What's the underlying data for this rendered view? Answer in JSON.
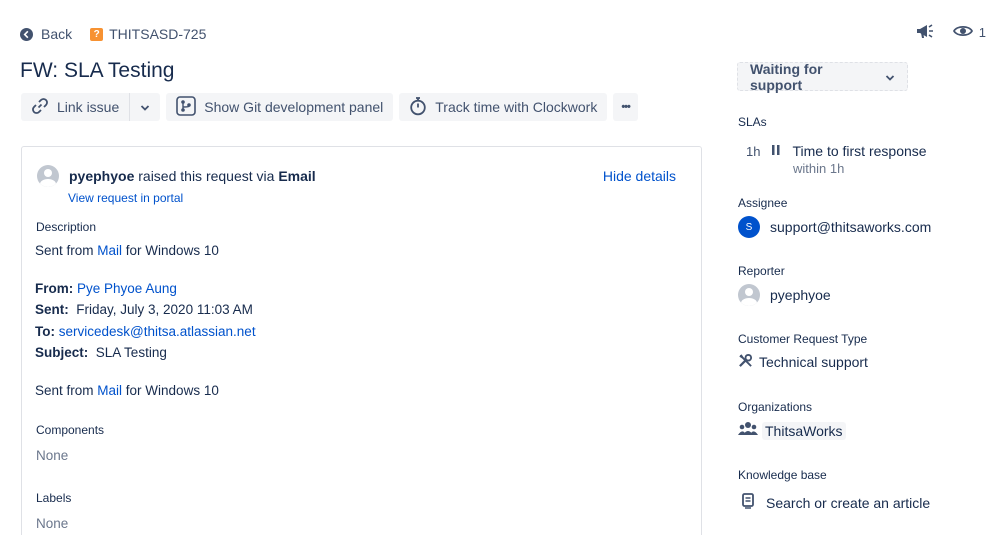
{
  "nav": {
    "back_label": "Back",
    "issue_key": "THITSASD-725",
    "watch_count": "1"
  },
  "issue": {
    "title": "FW: SLA Testing"
  },
  "toolbar": {
    "link_issue": "Link issue",
    "git_panel": "Show Git development panel",
    "track_time": "Track time with Clockwork",
    "more": "•••"
  },
  "request": {
    "reporter": "pyephyoe",
    "raised_text": "raised this request via",
    "channel": "Email",
    "view_portal": "View request in portal",
    "hide_details": "Hide details"
  },
  "description": {
    "label": "Description",
    "line1_prefix": "Sent from ",
    "line1_link": "Mail",
    "line1_suffix": " for Windows 10",
    "from_label": "From:",
    "from_value": "Pye Phyoe Aung",
    "sent_label": "Sent:",
    "sent_value": "Friday, July 3, 2020 11:03 AM",
    "to_label": "To:",
    "to_value": "servicedesk@thitsa.atlassian.net",
    "subject_label": "Subject:",
    "subject_value": "SLA Testing",
    "line2_prefix": "Sent from ",
    "line2_link": "Mail",
    "line2_suffix": " for Windows 10"
  },
  "fields": {
    "components_label": "Components",
    "components_value": "None",
    "labels_label": "Labels",
    "labels_value": "None"
  },
  "sidebar": {
    "status": "Waiting for support",
    "slas_label": "SLAs",
    "sla_time": "1h",
    "sla_name": "Time to first response",
    "sla_within": "within 1h",
    "assignee_label": "Assignee",
    "assignee_initial": "S",
    "assignee_value": "support@thitsaworks.com",
    "reporter_label": "Reporter",
    "reporter_value": "pyephyoe",
    "crt_label": "Customer Request Type",
    "crt_value": "Technical support",
    "org_label": "Organizations",
    "org_value": "ThitsaWorks",
    "kb_label": "Knowledge base",
    "kb_value": "Search or create an article"
  },
  "colors": {
    "link": "#0052cc",
    "text": "#172b4d",
    "subtle": "#42526e",
    "issue_type": "#f79232",
    "assignee_avatar": "#0052cc"
  }
}
